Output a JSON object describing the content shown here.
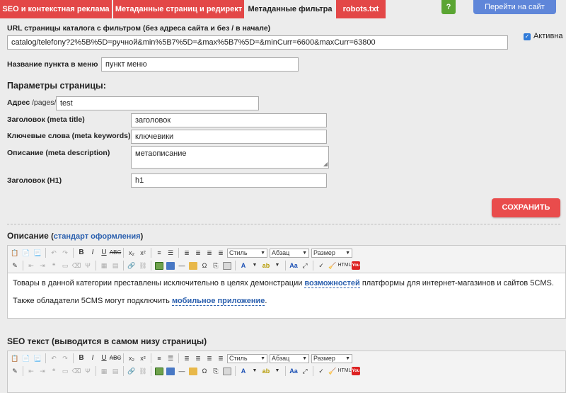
{
  "tabs": [
    {
      "label": "SEO и контекстная реклама"
    },
    {
      "label": "Метаданные страниц и редирект"
    },
    {
      "label": "Метаданные фильтра"
    },
    {
      "label": "robots.txt"
    }
  ],
  "header": {
    "help_label": "?",
    "goto_site_label": "Перейти на сайт"
  },
  "form": {
    "url_label": "URL страницы каталога с фильтром (без адреса сайта и без / в начале)",
    "url_value": "catalog/telefony?2%5B%5D=ручной&min%5B7%5D=&max%5B7%5D=&minCurr=6600&maxCurr=63800",
    "active_label": "Активна",
    "active_checked": true,
    "menu_name_label": "Название пункта в меню",
    "menu_name_value": "пункт меню",
    "page_params_title": "Параметры страницы:",
    "address_label": "Адрес",
    "address_prefix": "/pages/",
    "address_value": "test",
    "meta_title_label": "Заголовок (meta title)",
    "meta_title_value": "заголовок",
    "meta_keywords_label": "Ключевые слова (meta keywords)",
    "meta_keywords_value": "ключевики",
    "meta_description_label": "Описание (meta description)",
    "meta_description_value": "метаописание",
    "h1_label": "Заголовок (H1)",
    "h1_value": "h1",
    "save_label": "СОХРАНИТЬ"
  },
  "description": {
    "title": "Описание",
    "link_open": "(",
    "link_label": "стандарт оформления",
    "link_close": ")",
    "p1_before": "Товары в данной категории преставлены исключительно в целях демонстрации ",
    "p1_link": "возможностей",
    "p1_after": " платформы для интернет-магазинов и сайтов 5CMS.",
    "p2_before": "Также обладатели 5CMS могут подключить ",
    "p2_link": "мобильное приложение",
    "p2_after": "."
  },
  "seo_text": {
    "title": "SEO текст (выводится в самом низу страницы)"
  },
  "editor_toolbar": {
    "bold": "B",
    "italic": "I",
    "underline": "U",
    "strike": "ABC",
    "subscript": "x₂",
    "superscript": "x²",
    "style_combo": "Стиль",
    "format_combo": "Абзац",
    "size_combo": "Размер",
    "html_label": "HTML",
    "youtube_label": "You"
  },
  "colors": {
    "tab_red": "#e34747",
    "save_red": "#e94c4c",
    "help_green": "#5aa532",
    "goto_blue": "#5f86d9",
    "link_blue": "#2a5fae"
  }
}
